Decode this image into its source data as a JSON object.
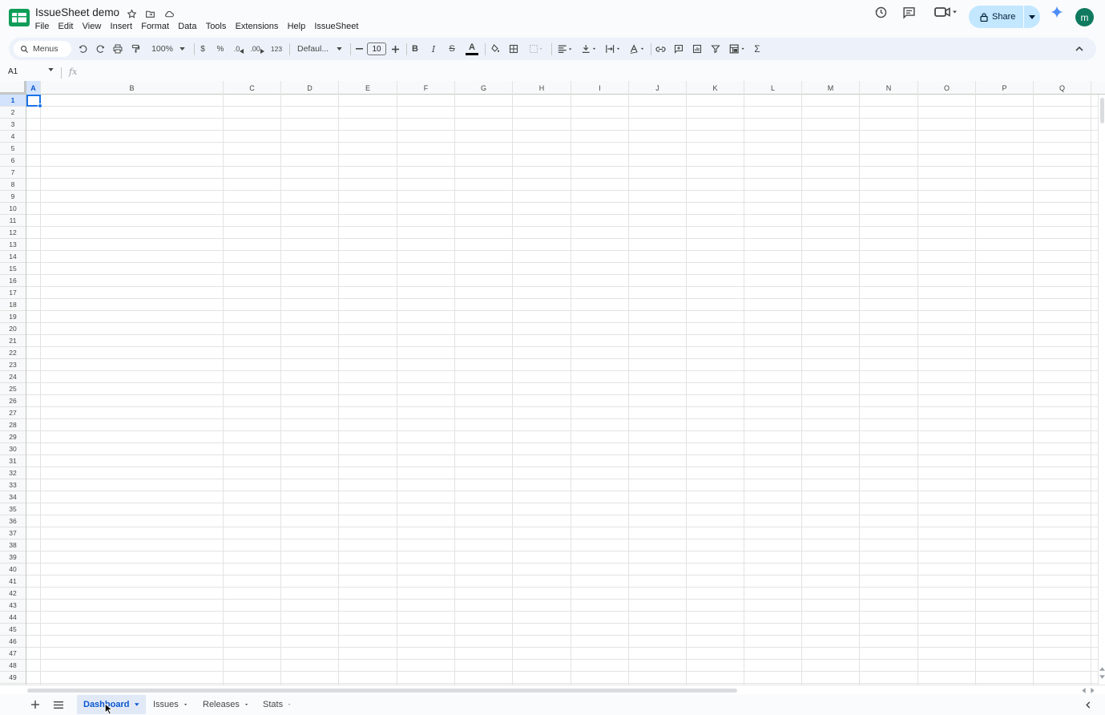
{
  "titlebar": {
    "doc_title": "IssueSheet demo",
    "menu": [
      "File",
      "Edit",
      "View",
      "Insert",
      "Format",
      "Data",
      "Tools",
      "Extensions",
      "Help",
      "IssueSheet"
    ]
  },
  "actions": {
    "share_label": "Share",
    "avatar_letter": "m"
  },
  "toolbar": {
    "search_label": "Menus",
    "zoom": "100%",
    "currency": "$",
    "percent": "%",
    "decrease_decimal": ".0",
    "increase_decimal": ".00",
    "number_format": "123",
    "font": "Defaul...",
    "font_size": "10",
    "bold": "B",
    "italic": "I",
    "strike": "S",
    "text_color_glyph": "A",
    "function_glyph": "Σ"
  },
  "formula_bar": {
    "cell_ref": "A1",
    "fx": "fx",
    "content": ""
  },
  "grid": {
    "columns": [
      "A",
      "B",
      "C",
      "D",
      "E",
      "F",
      "G",
      "H",
      "I",
      "J",
      "K",
      "L",
      "M",
      "N",
      "O",
      "P",
      "Q"
    ],
    "rows": [
      "1",
      "2",
      "3",
      "4",
      "5",
      "6",
      "7",
      "8",
      "9",
      "10",
      "11",
      "12",
      "13",
      "14",
      "15",
      "16",
      "17",
      "18",
      "19",
      "20",
      "21",
      "22",
      "23",
      "24",
      "25",
      "26",
      "27",
      "28",
      "29",
      "30",
      "31",
      "32",
      "33",
      "34",
      "35",
      "36",
      "37",
      "38",
      "39",
      "40",
      "41",
      "42",
      "43",
      "44",
      "45",
      "46",
      "47",
      "48",
      "49"
    ],
    "selected_cell": "A1"
  },
  "sheets": {
    "tabs": [
      "Dashboard",
      "Issues",
      "Releases",
      "Stats"
    ],
    "active": "Dashboard"
  },
  "colors": {
    "accent": "#0b57d0",
    "share_bg": "#c2e7ff",
    "avatar_bg": "#0f7a5f",
    "toolbar_bg": "#edf2fa"
  }
}
